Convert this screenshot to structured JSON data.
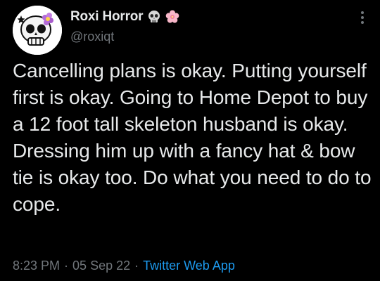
{
  "tweet": {
    "author": {
      "display_name": "Roxi Horror",
      "handle": "@roxiqt",
      "name_emojis": [
        "skull-emoji",
        "cherry-blossom-emoji"
      ]
    },
    "text": "Cancelling plans is okay. Putting yourself first is okay. Going to Home Depot to buy a 12 foot tall skeleton husband is okay. Dressing him up with a fancy hat & bow tie is okay too. Do what you need to do to cope.",
    "time": "8:23 PM",
    "separator": "·",
    "date": "05 Sep 22",
    "source": "Twitter Web App"
  },
  "colors": {
    "background": "#000000",
    "primary_text": "#e7e9ea",
    "secondary_text": "#71767b",
    "link": "#1d9bf0"
  },
  "icons": {
    "more": "more-vertical-icon"
  }
}
